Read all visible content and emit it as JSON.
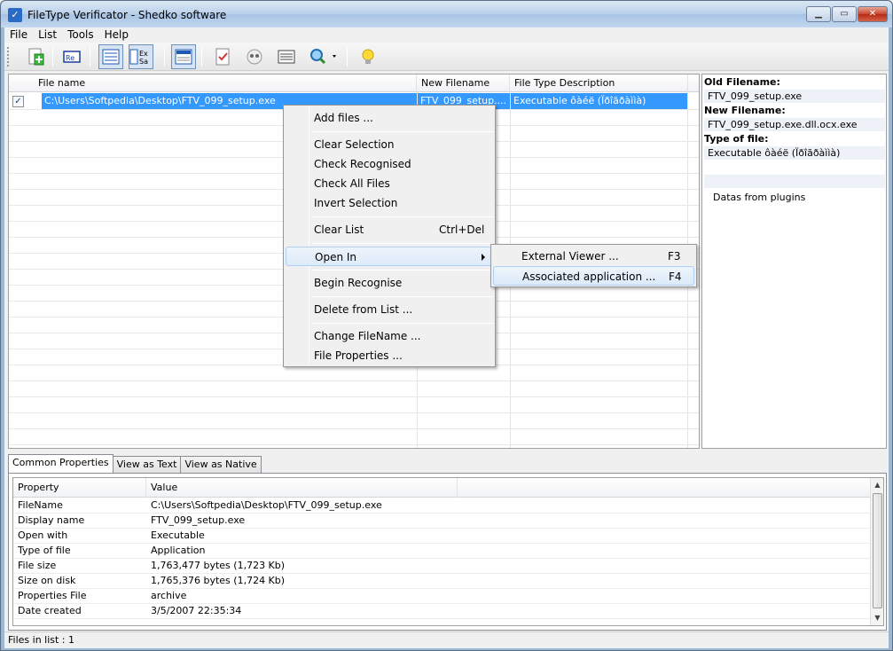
{
  "window": {
    "title": "FileType Verificator - Shedko software"
  },
  "menubar": [
    "File",
    "List",
    "Tools",
    "Help"
  ],
  "toolbar": {
    "buttons": [
      "add-files",
      "rename",
      "view-list",
      "view-extended",
      "view-detailed",
      "check",
      "recognise",
      "list-view",
      "search",
      "tip"
    ],
    "ex_label": "Ex",
    "sa_label": "Sa",
    "re_label": "Re"
  },
  "list": {
    "columns": [
      "File name",
      "New Filename",
      "File Type Description"
    ],
    "rows": [
      {
        "checked": true,
        "file_name": "C:\\Users\\Softpedia\\Desktop\\FTV_099_setup.exe",
        "new_filename": "FTV_099_setup....",
        "type": "Executable ôàéë (Ïðîãðàììà)"
      }
    ]
  },
  "info": {
    "old_label": "Old Filename:",
    "old_value": "FTV_099_setup.exe",
    "new_label": "New Filename:",
    "new_value": "FTV_099_setup.exe.dll.ocx.exe",
    "type_label": "Type of file:",
    "type_value": "Executable ôàéë (Ïðîãðàììà)",
    "plugins": "Datas from plugins"
  },
  "tabs": [
    "Common Properties",
    "View as Text",
    "View as Native"
  ],
  "properties": {
    "columns": [
      "Property",
      "Value"
    ],
    "rows": [
      {
        "property": "FileName",
        "value": "C:\\Users\\Softpedia\\Desktop\\FTV_099_setup.exe"
      },
      {
        "property": "Display name",
        "value": "FTV_099_setup.exe"
      },
      {
        "property": "Open with",
        "value": "Executable"
      },
      {
        "property": "Type of file",
        "value": "Application"
      },
      {
        "property": "File size",
        "value": "1,763,477 bytes (1,723 Kb)"
      },
      {
        "property": "Size on disk",
        "value": "1,765,376 bytes (1,724 Kb)"
      },
      {
        "property": "Properties File",
        "value": "archive"
      },
      {
        "property": "Date created",
        "value": "3/5/2007 22:35:34"
      }
    ]
  },
  "status": "Files in list : 1",
  "context_menu": {
    "items": [
      {
        "label": "Add files ...",
        "shortcut": ""
      },
      {
        "label": "Clear Selection",
        "shortcut": ""
      },
      {
        "label": "Check Recognised",
        "shortcut": ""
      },
      {
        "label": "Check All Files",
        "shortcut": ""
      },
      {
        "label": "Invert Selection",
        "shortcut": ""
      },
      {
        "label": "Clear List",
        "shortcut": "Ctrl+Del"
      },
      {
        "label": "Open In",
        "shortcut": ""
      },
      {
        "label": "Begin Recognise",
        "shortcut": ""
      },
      {
        "label": "Delete from List ...",
        "shortcut": ""
      },
      {
        "label": "Change FileName ...",
        "shortcut": ""
      },
      {
        "label": "File Properties ...",
        "shortcut": ""
      }
    ]
  },
  "submenu": {
    "items": [
      {
        "label": "External Viewer ...",
        "shortcut": "F3"
      },
      {
        "label": "Associated application ...",
        "shortcut": "F4"
      }
    ]
  },
  "colors": {
    "selection": "#3399ff",
    "title_bar": "#b9d0ea",
    "close_button": "#c7472f"
  }
}
